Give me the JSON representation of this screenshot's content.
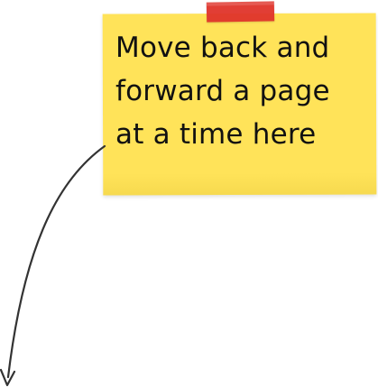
{
  "sticky_note": {
    "text": "Move back and\nforward a page\nat a time here",
    "background_color": "#FFE359",
    "tape_color": "#E0342B",
    "text_color": "#111111"
  },
  "arrow": {
    "icon": "curved-arrow-down-left-icon",
    "color": "#333333"
  }
}
